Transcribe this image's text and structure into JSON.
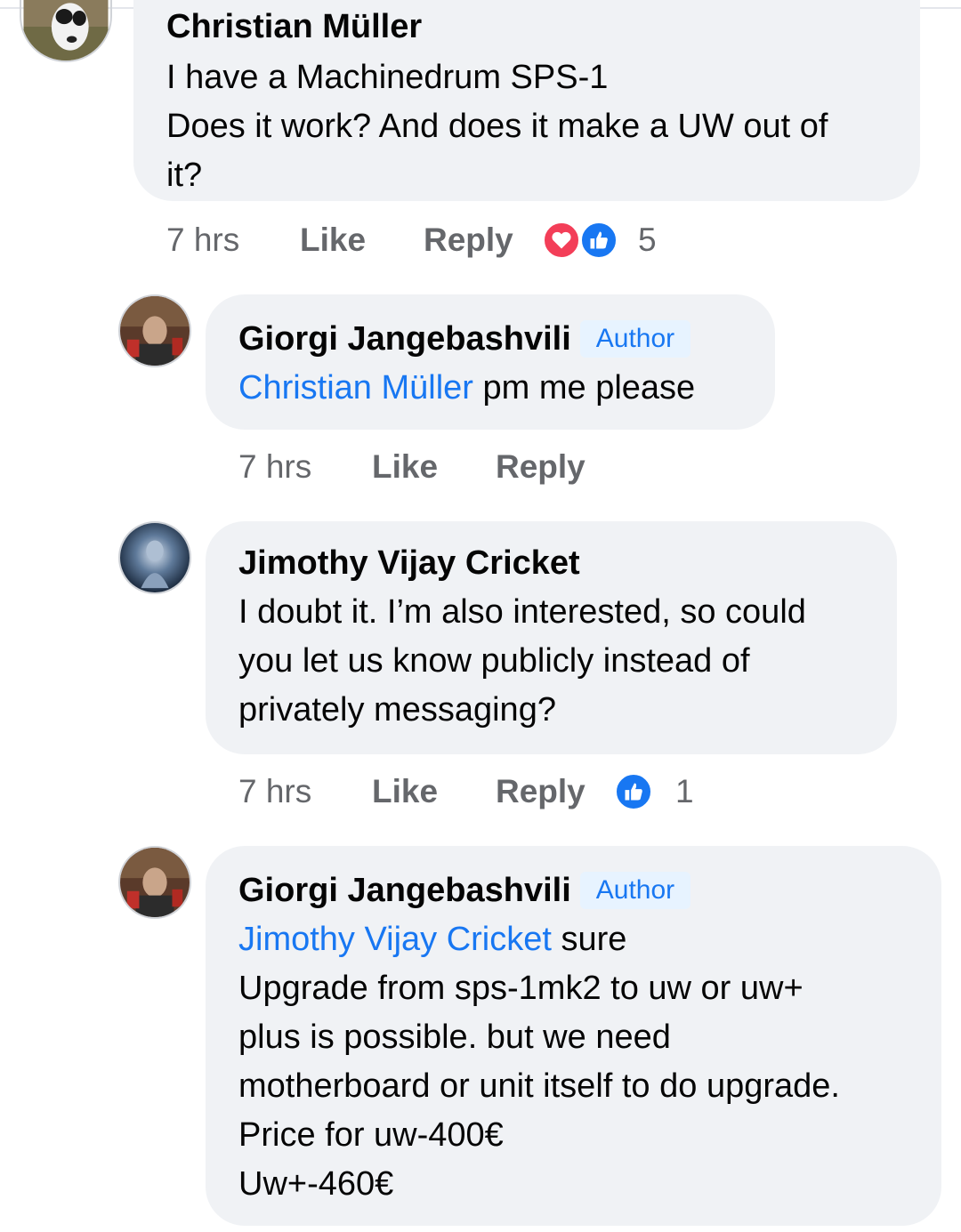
{
  "comments": [
    {
      "author": "Christian Müller",
      "lines": [
        "I have a Machinedrum SPS-1",
        "Does it work? And does it make a UW out of",
        "it?"
      ],
      "time": "7 hrs",
      "like": "Like",
      "reply": "Reply",
      "reactions": [
        "heart-react-icon",
        "like-react-icon"
      ],
      "reaction_count": "5"
    },
    {
      "author": "Giorgi Jangebashvili",
      "badge": "Author",
      "mention": "Christian Müller",
      "lines": [
        " pm me please"
      ],
      "time": "7 hrs",
      "like": "Like",
      "reply": "Reply"
    },
    {
      "author": "Jimothy Vijay Cricket",
      "lines": [
        "I doubt it. I’m also interested, so could",
        "you let us know publicly instead of",
        "privately messaging?"
      ],
      "time": "7 hrs",
      "like": "Like",
      "reply": "Reply",
      "reactions": [
        "like-react-icon"
      ],
      "reaction_count": "1"
    },
    {
      "author": "Giorgi Jangebashvili",
      "badge": "Author",
      "mention": "Jimothy Vijay Cricket",
      "lines": [
        " sure",
        "Upgrade from sps-1mk2 to uw or uw+",
        "plus is possible. but we need",
        "motherboard or unit itself to do upgrade.",
        "Price for uw-400€",
        "Uw+-460€"
      ]
    }
  ],
  "colors": {
    "bubble": "#f0f2f5",
    "link": "#1877f2",
    "meta": "#65676b",
    "like_blue": "#1877f2",
    "love_red": "#f33e58"
  }
}
